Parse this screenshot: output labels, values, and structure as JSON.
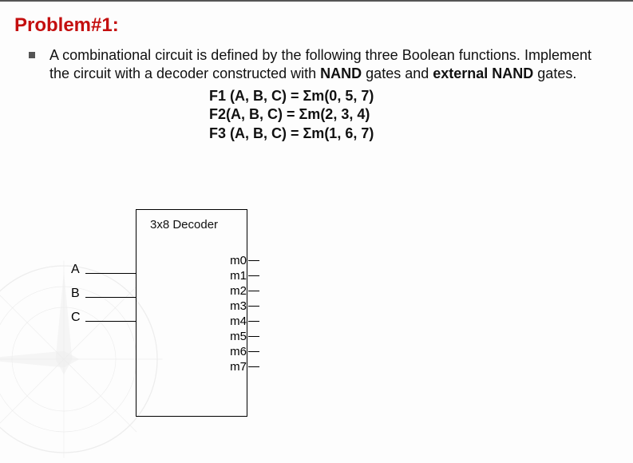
{
  "title": "Problem#1:",
  "body": {
    "part1": "A combinational circuit is defined by the following three Boolean functions. Implement the circuit with a decoder constructed with ",
    "bold1": "NAND",
    "part2": " gates and ",
    "bold2": "external NAND",
    "part3": " gates."
  },
  "equations": {
    "f1": "F1 (A, B, C)  = Σm(0, 5, 7)",
    "f2": "F2(A, B, C)  = Σm(2, 3, 4)",
    "f3": "F3 (A, B, C)  = Σm(1, 6, 7)"
  },
  "diagram": {
    "title": "3x8 Decoder",
    "inputs": [
      "A",
      "B",
      "C"
    ],
    "outputs": [
      "m0",
      "m1",
      "m2",
      "m3",
      "m4",
      "m5",
      "m6",
      "m7"
    ]
  }
}
